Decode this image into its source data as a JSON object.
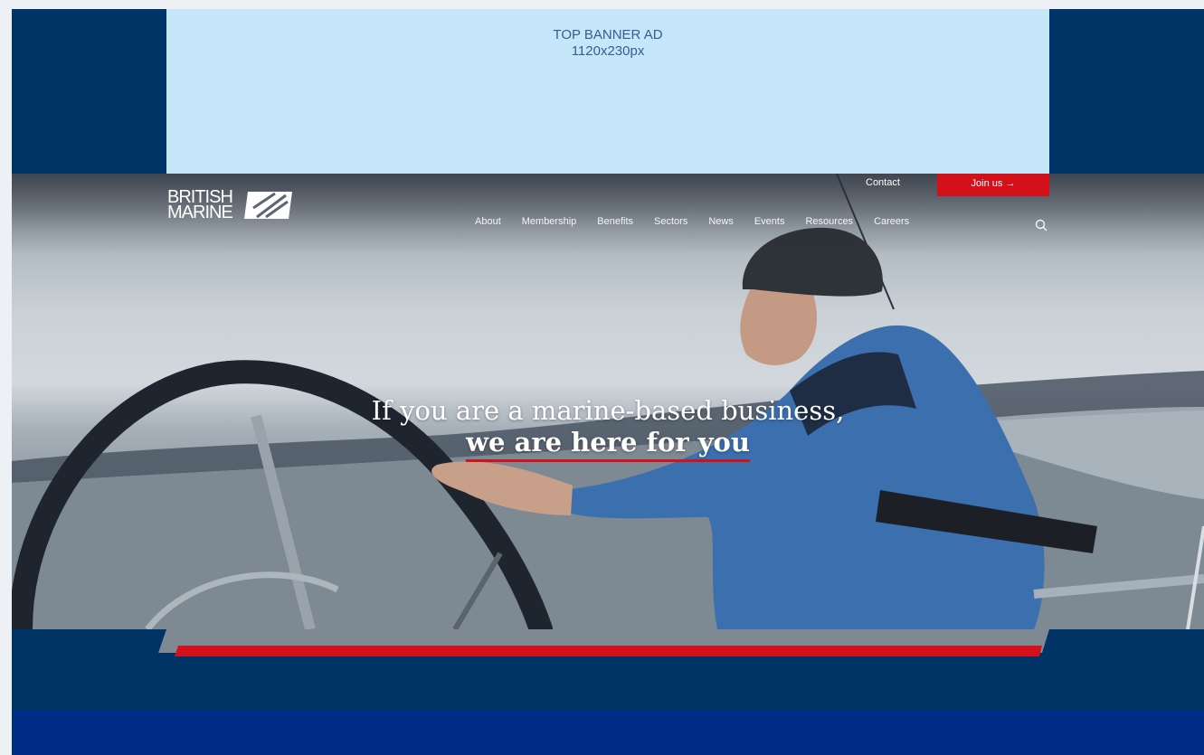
{
  "ad": {
    "line1": "TOP BANNER AD",
    "line2": "1120x230px"
  },
  "brand": {
    "line1": "BRITISH",
    "line2": "MARINE"
  },
  "header": {
    "contact_label": "Contact",
    "join_label": "Join us →"
  },
  "nav": {
    "items": [
      "About",
      "Membership",
      "Benefits",
      "Sectors",
      "News",
      "Events",
      "Resources",
      "Careers"
    ]
  },
  "hero": {
    "headline_line1": "If you are a marine-based business,",
    "headline_line2": "we are here for you"
  },
  "colors": {
    "navy": "#003366",
    "ad_bg": "#c5e7f9",
    "accent_red": "#d4111b",
    "deep_blue": "#002b87"
  }
}
